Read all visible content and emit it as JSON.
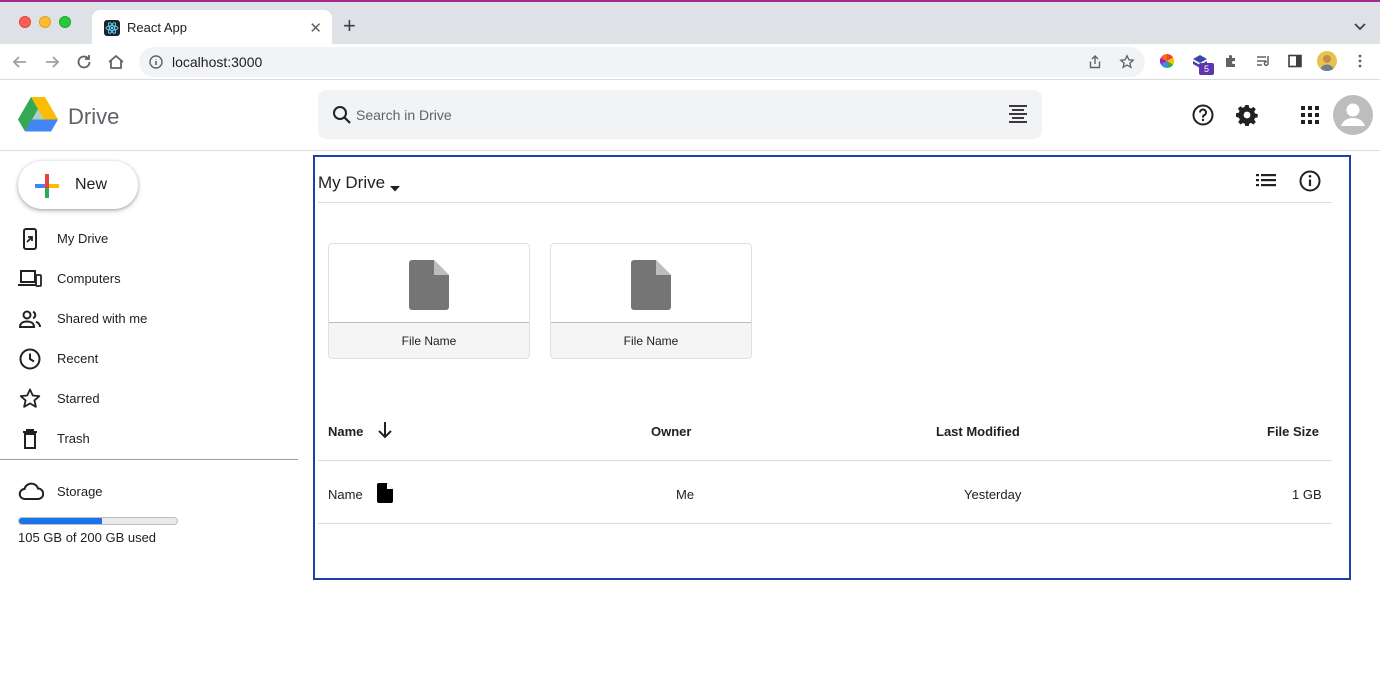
{
  "browser": {
    "tab_title": "React App",
    "url": "localhost:3000",
    "extension_badge": "5"
  },
  "header": {
    "app_name": "Drive",
    "search_placeholder": "Search in Drive"
  },
  "sidebar": {
    "new_label": "New",
    "items": [
      {
        "label": "My Drive",
        "icon": "my-drive-icon"
      },
      {
        "label": "Computers",
        "icon": "computers-icon"
      },
      {
        "label": "Shared with me",
        "icon": "shared-icon"
      },
      {
        "label": "Recent",
        "icon": "clock-icon"
      },
      {
        "label": "Starred",
        "icon": "star-icon"
      },
      {
        "label": "Trash",
        "icon": "trash-icon"
      }
    ],
    "storage": {
      "label": "Storage",
      "used_text": "105 GB of 200 GB used",
      "used_fraction": 0.525
    }
  },
  "main": {
    "title": "My Drive",
    "cards": [
      {
        "name": "File Name"
      },
      {
        "name": "File Name"
      }
    ],
    "table": {
      "columns": [
        "Name",
        "Owner",
        "Last Modified",
        "File Size"
      ],
      "rows": [
        {
          "name": "Name",
          "owner": "Me",
          "modified": "Yesterday",
          "size": "1 GB"
        }
      ]
    }
  },
  "colors": {
    "accent": "#1a73e8",
    "main_border": "#1b3fae"
  }
}
